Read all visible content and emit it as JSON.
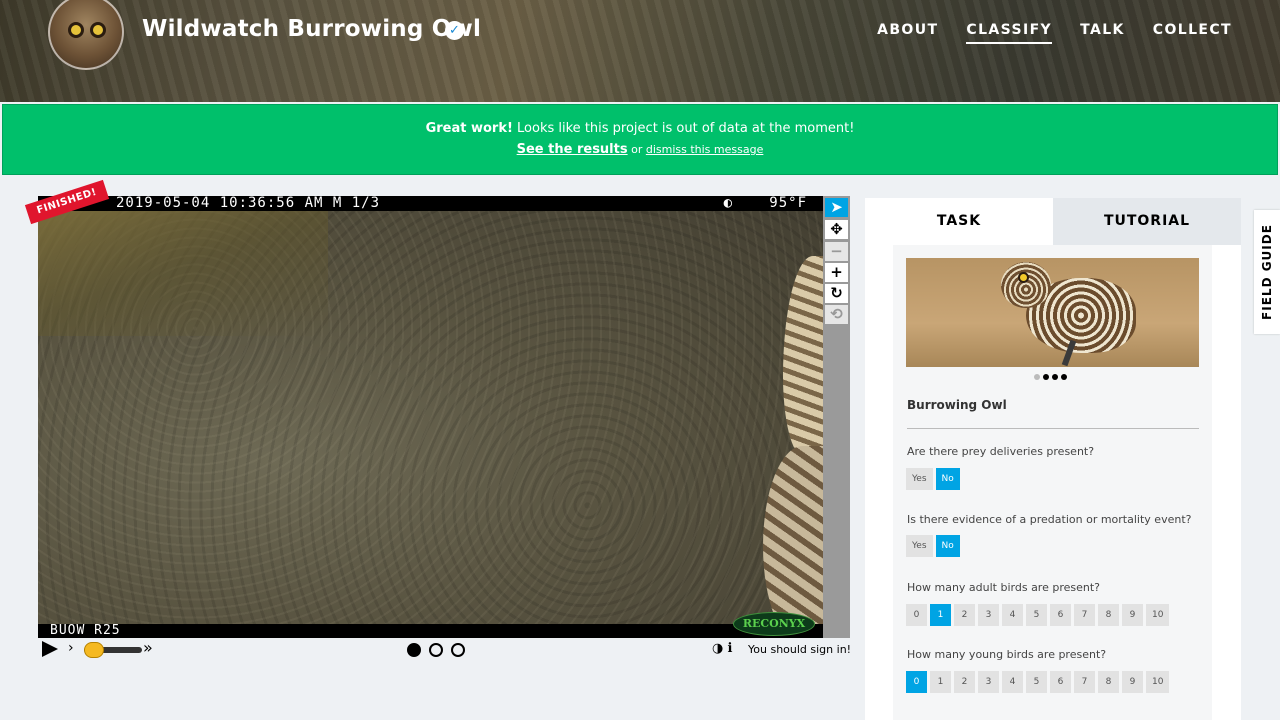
{
  "header": {
    "project_title": "Wildwatch Burrowing Owl",
    "verified_mark": "✓",
    "nav": [
      "ABOUT",
      "CLASSIFY",
      "TALK",
      "COLLECT"
    ]
  },
  "banner": {
    "strong": "Great work!",
    "message": " Looks like this project is out of data at the moment!",
    "results_link": "See the results",
    "or": " or ",
    "dismiss_link": "dismiss this message",
    "color": "#00c06b"
  },
  "subject": {
    "stamp_top": "2019-05-04 10:36:56 AM  M 1/3",
    "stamp_moon": "◐",
    "stamp_temp": "95°F",
    "stamp_bottom": "BUOW R25",
    "brand": "RECONYX",
    "finished_label": "FINISHED!"
  },
  "toolbar": {
    "icons": [
      "pointer-icon",
      "move-icon",
      "zoom-out-icon",
      "zoom-in-icon",
      "rotate-icon",
      "reset-icon"
    ],
    "glyphs": [
      "➤",
      "✥",
      "−",
      "+",
      "↻",
      "⟲"
    ]
  },
  "controls": {
    "slow": "›",
    "fast": "»",
    "invert_icon": "◑",
    "info_icon": "ℹ",
    "signin": "You should sign in!"
  },
  "tabs": [
    "TASK",
    "TUTORIAL"
  ],
  "task": {
    "species": "Burrowing Owl",
    "questions": [
      {
        "q": "Are there prey deliveries present?",
        "options": [
          "Yes",
          "No"
        ],
        "selected": "No"
      },
      {
        "q": "Is there evidence of a predation or mortality event?",
        "options": [
          "Yes",
          "No"
        ],
        "selected": "No"
      },
      {
        "q": "How many adult birds are present?",
        "options": [
          "0",
          "1",
          "2",
          "3",
          "4",
          "5",
          "6",
          "7",
          "8",
          "9",
          "10"
        ],
        "selected": "1"
      },
      {
        "q": "How many young birds are present?",
        "options": [
          "0",
          "1",
          "2",
          "3",
          "4",
          "5",
          "6",
          "7",
          "8",
          "9",
          "10"
        ],
        "selected": "0"
      }
    ]
  },
  "field_guide": "FIELD GUIDE",
  "colors": {
    "accent": "#00a4e4",
    "finished": "#e0152d"
  }
}
